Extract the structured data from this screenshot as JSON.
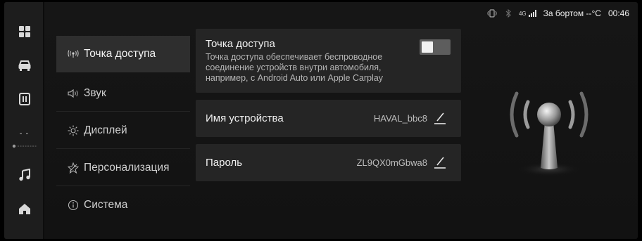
{
  "status_bar": {
    "network": "4G",
    "outside_label": "За бортом",
    "outside_temp": "--°C",
    "time": "00:46"
  },
  "dock": {
    "items": [
      {
        "icon": "apps-grid-icon"
      },
      {
        "icon": "car-icon"
      },
      {
        "icon": "phone-mirror-icon"
      },
      {
        "icon": "climate-icon",
        "value": "- -"
      },
      {
        "icon": "music-icon"
      },
      {
        "icon": "home-icon"
      }
    ]
  },
  "menu": {
    "items": [
      {
        "label": "Точка доступа",
        "icon": "hotspot-icon",
        "active": true
      },
      {
        "label": "Звук",
        "icon": "speaker-icon"
      },
      {
        "label": "Дисплей",
        "icon": "brightness-icon"
      },
      {
        "label": "Персонализация",
        "icon": "personalization-icon"
      },
      {
        "label": "Система",
        "icon": "info-icon"
      }
    ]
  },
  "hotspot": {
    "title": "Точка доступа",
    "description": "Точка доступа обеспечивает беспроводное соединение устройств внутри автомобиля, например, с Android Auto или Apple Carplay",
    "enabled": false
  },
  "device_name": {
    "label": "Имя устройства",
    "value": "HAVAL_bbc8"
  },
  "password": {
    "label": "Пароль",
    "value": "ZL9QX0mGbwa8"
  },
  "colors": {
    "background": "#141414",
    "card": "#252525",
    "active_menu": "#2e2e2e",
    "toggle_off": "#5d5d5d",
    "text": "#f0f0f0"
  }
}
